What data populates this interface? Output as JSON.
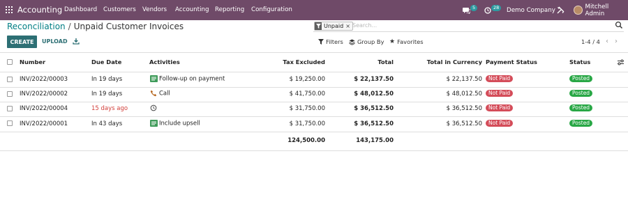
{
  "nav": {
    "brand": "Accounting",
    "menu": [
      "Dashboard",
      "Customers",
      "Vendors",
      "Accounting",
      "Reporting",
      "Configuration"
    ],
    "messages_count": "5",
    "activities_count": "28",
    "company": "Demo Company",
    "user": "Mitchell Admin",
    "icons": [
      "apps-grid-icon",
      "chat-icon",
      "clock-icon",
      "debug-tools-icon",
      "avatar"
    ]
  },
  "breadcrumb": {
    "parent": "Reconciliation",
    "separator": "/",
    "current": "Unpaid Customer Invoices"
  },
  "search": {
    "facet": "Unpaid",
    "facet_remove": "×",
    "placeholder": "Search..."
  },
  "actions": {
    "create": "CREATE",
    "upload": "UPLOAD",
    "filters": "Filters",
    "group_by": "Group By",
    "favorites": "Favorites",
    "pager": "1-4 / 4"
  },
  "table": {
    "headers": {
      "number": "Number",
      "due_date": "Due Date",
      "activities": "Activities",
      "tax_excluded": "Tax Excluded",
      "total": "Total",
      "total_currency": "Total in Currency",
      "payment_status": "Payment Status",
      "status": "Status"
    },
    "rows": [
      {
        "number": "INV/2022/00003",
        "due": "In 19 days",
        "activity": "Follow-up on payment",
        "activity_icon": "todo-icon",
        "tax_excluded": "$ 19,250.00",
        "total": "$ 22,137.50",
        "total_currency": "$ 22,137.50",
        "payment_status": "Not Paid",
        "status": "Posted",
        "overdue": false
      },
      {
        "number": "INV/2022/00002",
        "due": "In 19 days",
        "activity": "Call",
        "activity_icon": "phone-icon",
        "tax_excluded": "$ 41,750.00",
        "total": "$ 48,012.50",
        "total_currency": "$ 48,012.50",
        "payment_status": "Not Paid",
        "status": "Posted",
        "overdue": false
      },
      {
        "number": "INV/2022/00004",
        "due": "15 days ago",
        "activity": "",
        "activity_icon": "clock-icon",
        "tax_excluded": "$ 31,750.00",
        "total": "$ 36,512.50",
        "total_currency": "$ 36,512.50",
        "payment_status": "Not Paid",
        "status": "Posted",
        "overdue": true
      },
      {
        "number": "INV/2022/00001",
        "due": "In 43 days",
        "activity": "Include upsell",
        "activity_icon": "todo-icon",
        "tax_excluded": "$ 31,750.00",
        "total": "$ 36,512.50",
        "total_currency": "$ 36,512.50",
        "payment_status": "Not Paid",
        "status": "Posted",
        "overdue": false
      }
    ],
    "totals": {
      "tax_excluded": "124,500.00",
      "total": "143,175.00"
    }
  },
  "colors": {
    "navbar": "#6f4a68",
    "primary": "#2d6f74",
    "link": "#017e84",
    "not_paid": "#d44c59",
    "posted": "#28a745",
    "overdue": "#d23f3a"
  }
}
